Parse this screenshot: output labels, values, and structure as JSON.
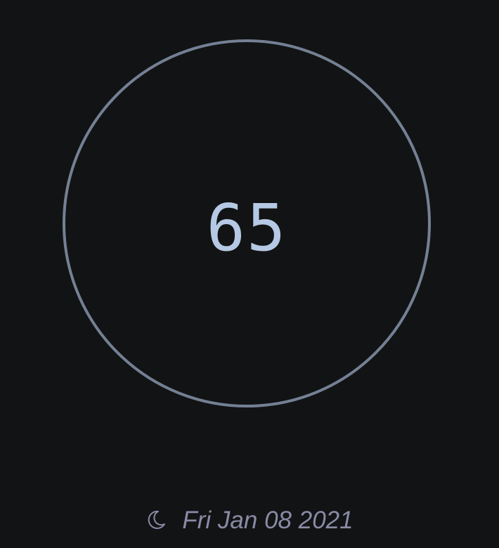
{
  "colors": {
    "background": "#121314",
    "ring": "#748094",
    "value_text": "#b5c8e4",
    "footer_text": "#8a8aa6"
  },
  "gauge": {
    "value": "65"
  },
  "footer": {
    "icon": "moon-icon",
    "date": "Fri Jan 08 2021"
  }
}
